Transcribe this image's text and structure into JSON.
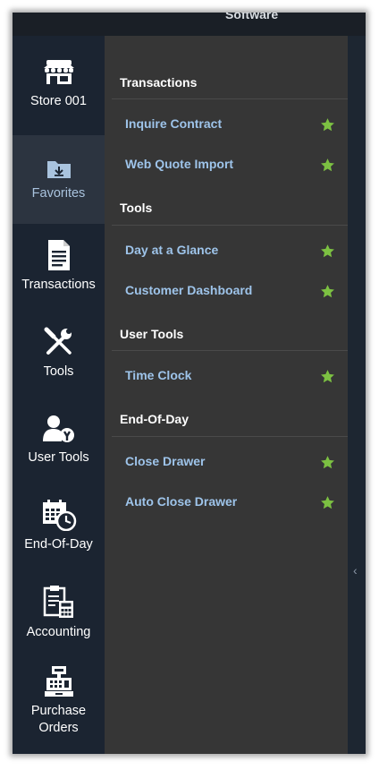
{
  "header": {
    "title": "Software"
  },
  "nav": {
    "store": "Store 001",
    "favorites": "Favorites",
    "transactions": "Transactions",
    "tools": "Tools",
    "user_tools": "User Tools",
    "end_of_day": "End-Of-Day",
    "accounting": "Accounting",
    "purchase_orders_line1": "Purchase",
    "purchase_orders_line2": "Orders"
  },
  "favorites_panel": {
    "sections": [
      {
        "title": "Transactions",
        "items": [
          "Inquire Contract",
          "Web Quote Import"
        ]
      },
      {
        "title": "Tools",
        "items": [
          "Day at a Glance",
          "Customer Dashboard"
        ]
      },
      {
        "title": "User Tools",
        "items": [
          "Time Clock"
        ]
      },
      {
        "title": "End-Of-Day",
        "items": [
          "Close Drawer",
          "Auto Close Drawer"
        ]
      }
    ]
  },
  "collapse_arrow": "‹",
  "colors": {
    "star": "#7cc142",
    "link": "#9ec4ea",
    "panel": "#363636",
    "nav": "#1b2431"
  },
  "icons": {
    "store": "store-icon",
    "favorites": "folder-download-icon",
    "transactions": "document-icon",
    "tools": "tools-icon",
    "user_tools": "user-gear-icon",
    "end_of_day": "calendar-clock-icon",
    "accounting": "clipboard-calculator-icon",
    "purchase_orders": "cash-register-icon",
    "favorite": "star-icon"
  }
}
